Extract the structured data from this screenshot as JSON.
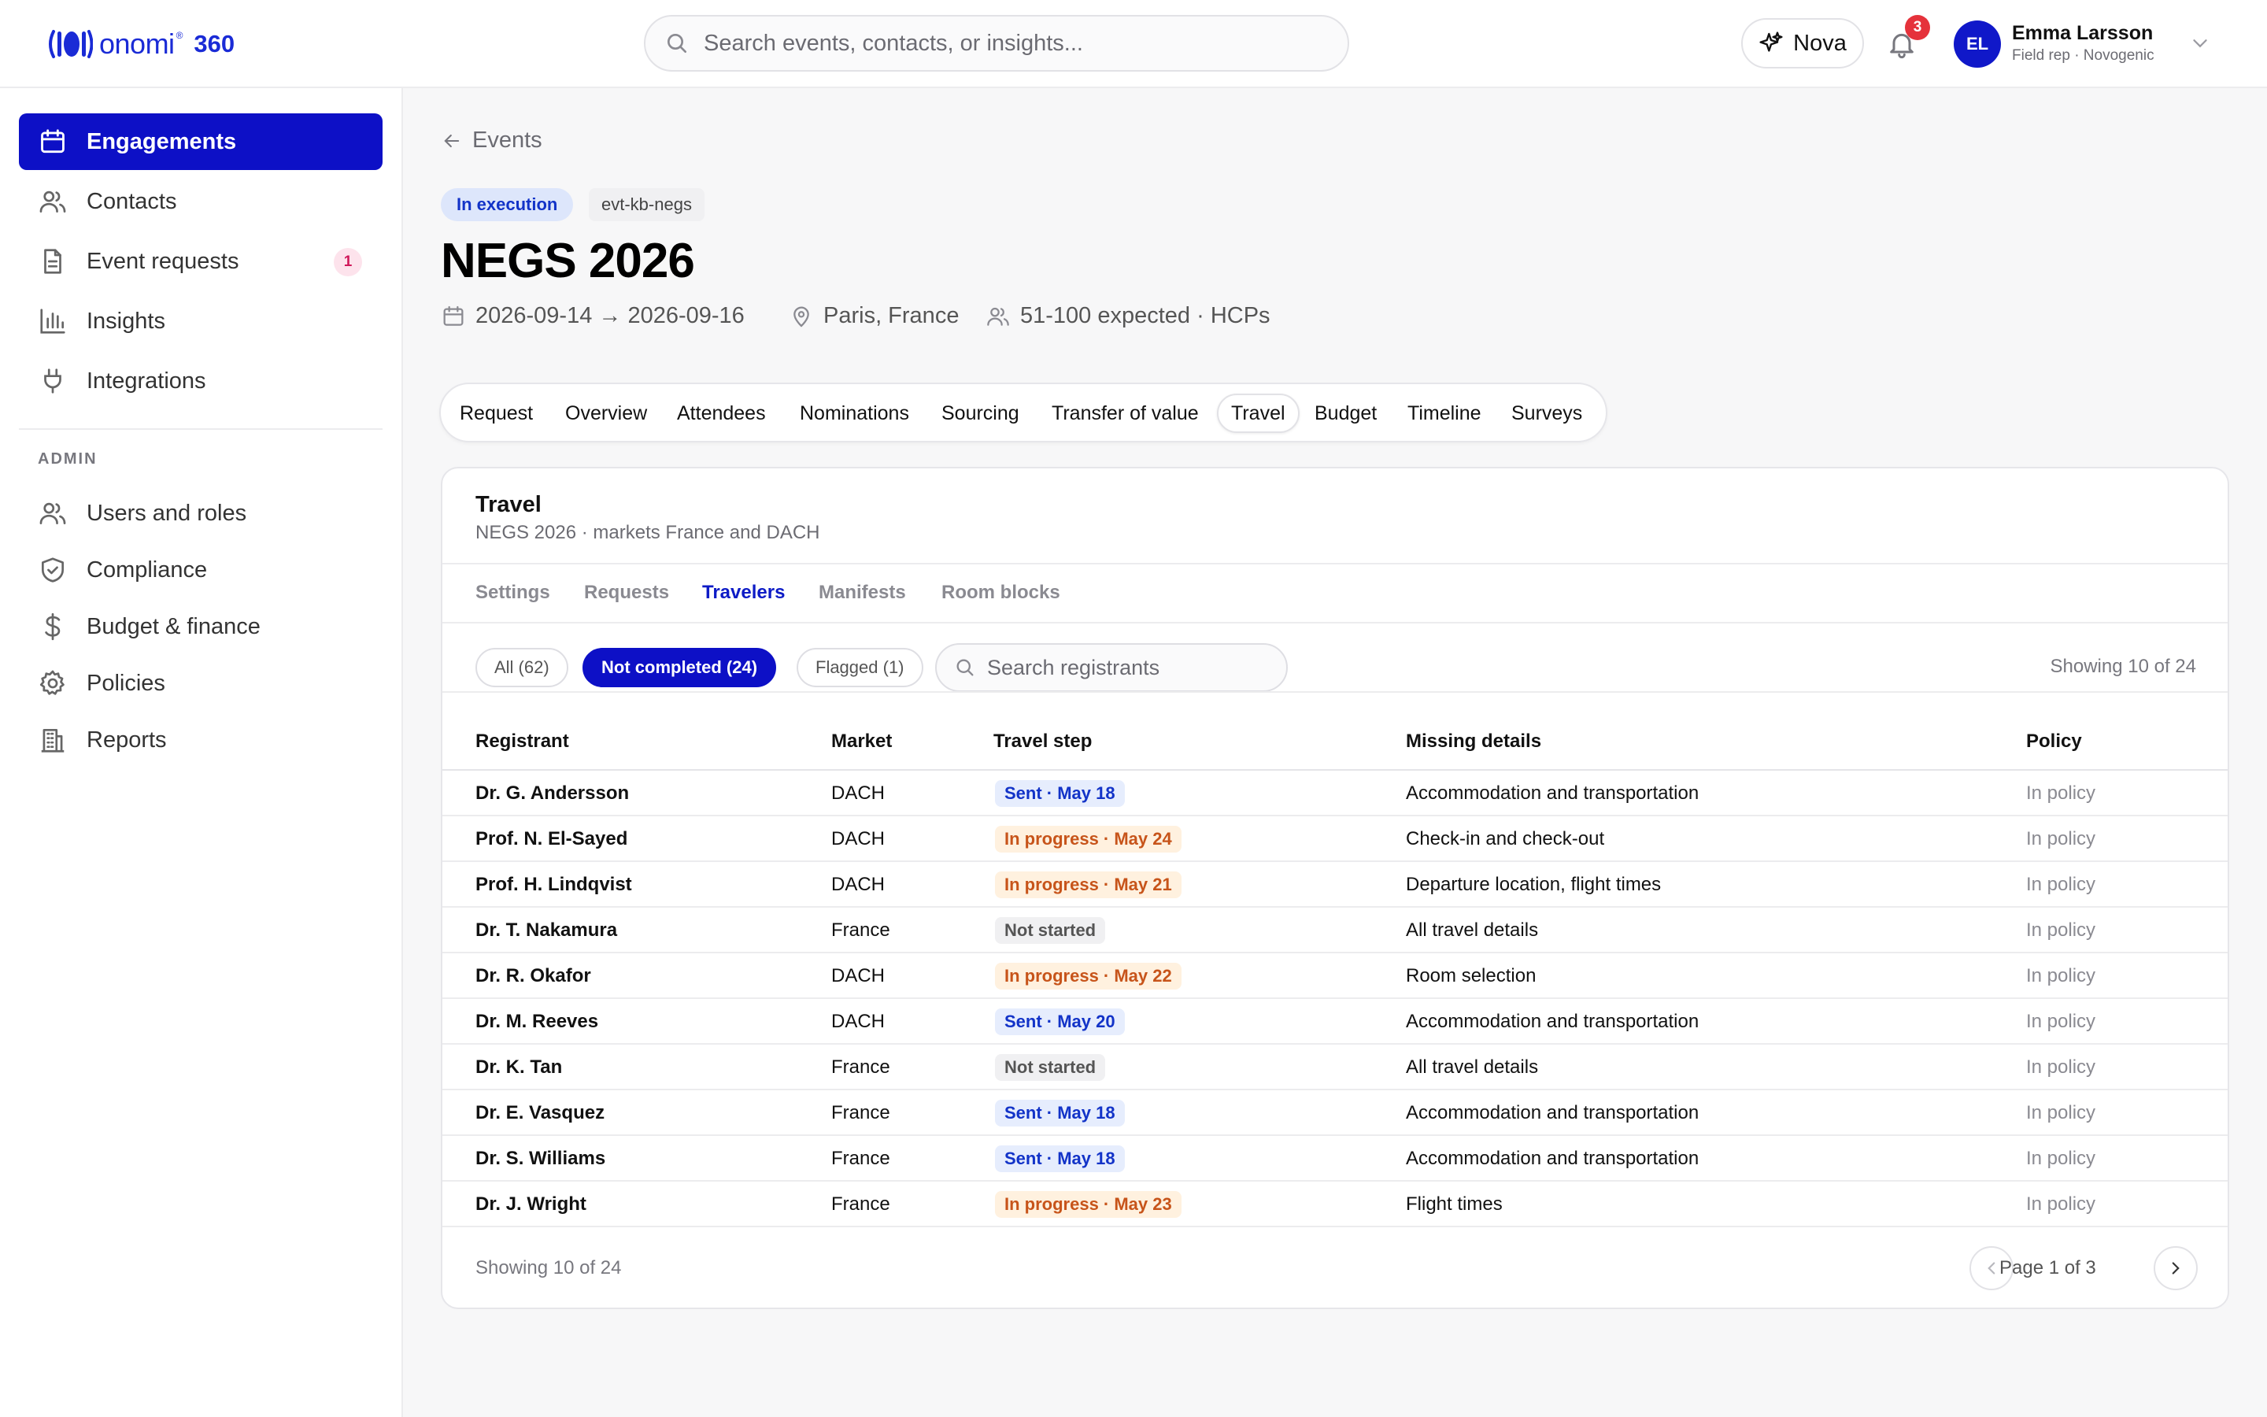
{
  "app": {
    "logo_word": "onomi",
    "logo_reg": "®",
    "logo_num": "360"
  },
  "topbar": {
    "search_placeholder": "Search events, contacts, or insights...",
    "nova_label": "Nova",
    "notifications_count": "3",
    "user": {
      "initials": "EL",
      "name": "Emma Larsson",
      "role": "Field rep · Novogenic"
    }
  },
  "sidebar": {
    "items": [
      {
        "label": "Engagements",
        "icon": "calendar-icon",
        "active": true
      },
      {
        "label": "Contacts",
        "icon": "users-icon"
      },
      {
        "label": "Event requests",
        "icon": "document-icon",
        "badge": "1"
      },
      {
        "label": "Insights",
        "icon": "bar-chart-icon"
      },
      {
        "label": "Integrations",
        "icon": "plug-icon"
      }
    ],
    "admin_label": "ADMIN",
    "admin_items": [
      {
        "label": "Users and roles",
        "icon": "users-icon"
      },
      {
        "label": "Compliance",
        "icon": "shield-icon"
      },
      {
        "label": "Budget & finance",
        "icon": "dollar-icon"
      },
      {
        "label": "Policies",
        "icon": "gear-icon"
      },
      {
        "label": "Reports",
        "icon": "building-icon"
      }
    ]
  },
  "event": {
    "back_label": "Events",
    "status": "In execution",
    "id": "evt-kb-negs",
    "title": "NEGS 2026",
    "dates": "2026-09-14 → 2026-09-16",
    "location": "Paris, France",
    "attendance": "51-100 expected · HCPs"
  },
  "tabs": [
    "Request",
    "Overview",
    "Attendees",
    "Nominations",
    "Sourcing",
    "Transfer of value",
    "Travel",
    "Budget",
    "Timeline",
    "Surveys"
  ],
  "active_tab": "Travel",
  "travel": {
    "title": "Travel",
    "subtitle": "NEGS 2026 · markets France and DACH",
    "subtabs": [
      "Settings",
      "Requests",
      "Travelers",
      "Manifests",
      "Room blocks"
    ],
    "active_subtab": "Travelers",
    "filters": {
      "all": "All (62)",
      "not_completed": "Not completed (24)",
      "flagged": "Flagged (1)"
    },
    "search_placeholder": "Search registrants",
    "showing": "Showing 10 of 24",
    "columns": {
      "registrant": "Registrant",
      "market": "Market",
      "step": "Travel step",
      "missing": "Missing details",
      "policy": "Policy"
    },
    "rows": [
      {
        "name": "Dr. G. Andersson",
        "market": "DACH",
        "step": "Sent · May 18",
        "status": "sent",
        "missing": "Accommodation and transportation",
        "policy": "In policy"
      },
      {
        "name": "Prof. N. El-Sayed",
        "market": "DACH",
        "step": "In progress · May 24",
        "status": "progress",
        "missing": "Check-in and check-out",
        "policy": "In policy"
      },
      {
        "name": "Prof. H. Lindqvist",
        "market": "DACH",
        "step": "In progress · May 21",
        "status": "progress",
        "missing": "Departure location, flight times",
        "policy": "In policy"
      },
      {
        "name": "Dr. T. Nakamura",
        "market": "France",
        "step": "Not started",
        "status": "none",
        "missing": "All travel details",
        "policy": "In policy"
      },
      {
        "name": "Dr. R. Okafor",
        "market": "DACH",
        "step": "In progress · May 22",
        "status": "progress",
        "missing": "Room selection",
        "policy": "In policy"
      },
      {
        "name": "Dr. M. Reeves",
        "market": "DACH",
        "step": "Sent · May 20",
        "status": "sent",
        "missing": "Accommodation and transportation",
        "policy": "In policy"
      },
      {
        "name": "Dr. K. Tan",
        "market": "France",
        "step": "Not started",
        "status": "none",
        "missing": "All travel details",
        "policy": "In policy"
      },
      {
        "name": "Dr. E. Vasquez",
        "market": "France",
        "step": "Sent · May 18",
        "status": "sent",
        "missing": "Accommodation and transportation",
        "policy": "In policy"
      },
      {
        "name": "Dr. S. Williams",
        "market": "France",
        "step": "Sent · May 18",
        "status": "sent",
        "missing": "Accommodation and transportation",
        "policy": "In policy"
      },
      {
        "name": "Dr. J. Wright",
        "market": "France",
        "step": "In progress · May 23",
        "status": "progress",
        "missing": "Flight times",
        "policy": "In policy"
      }
    ],
    "footer_showing": "Showing 10 of 24",
    "page_label": "Page 1 of 3"
  },
  "colors": {
    "brand": "#1a2bd6",
    "accent": "#0d10c6",
    "sent": "#1233c8",
    "in_progress": "#c7541a",
    "alert": "#e5323b"
  }
}
